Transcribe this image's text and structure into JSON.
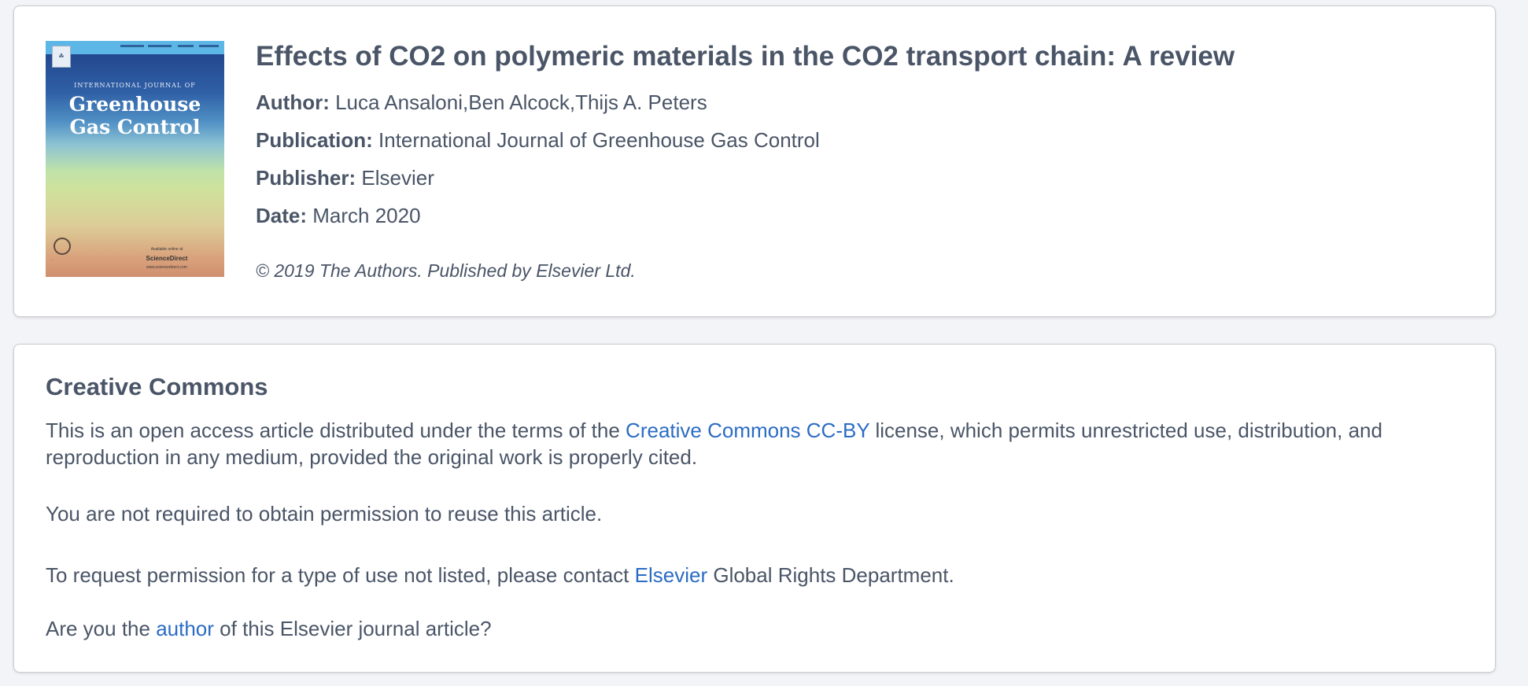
{
  "article": {
    "title": "Effects of CO2 on polymeric materials in the CO2 transport chain: A review",
    "author_label": "Author:",
    "author": "Luca Ansaloni,Ben Alcock,Thijs A. Peters",
    "publication_label": "Publication:",
    "publication": "International Journal of Greenhouse Gas Control",
    "publisher_label": "Publisher:",
    "publisher": "Elsevier",
    "date_label": "Date:",
    "date": "March 2020",
    "copyright": "© 2019 The Authors. Published by Elsevier Ltd."
  },
  "cover": {
    "journal_small": "INTERNATIONAL JOURNAL OF",
    "journal_line1": "Greenhouse",
    "journal_line2": "Gas Control",
    "available": "Available online at",
    "sciencedirect": "ScienceDirect",
    "url": "www.sciencedirect.com"
  },
  "license": {
    "heading": "Creative Commons",
    "cc_text_before": "This is an open access article distributed under the terms of the ",
    "cc_link": "Creative Commons CC-BY",
    "cc_text_after": " license, which permits unrestricted use, distribution, and reproduction in any medium, provided the original work is properly cited.",
    "not_required": "You are not required to obtain permission to reuse this article.",
    "contact_before": "To request permission for a type of use not listed, please contact ",
    "contact_link": "Elsevier",
    "contact_after": " Global Rights Department.",
    "author_before": "Are you the ",
    "author_link": "author",
    "author_after": " of this Elsevier journal article?"
  },
  "colors": {
    "text": "#4a5567",
    "link": "#2b6cc4",
    "background": "#f3f4f7",
    "card": "#ffffff"
  }
}
